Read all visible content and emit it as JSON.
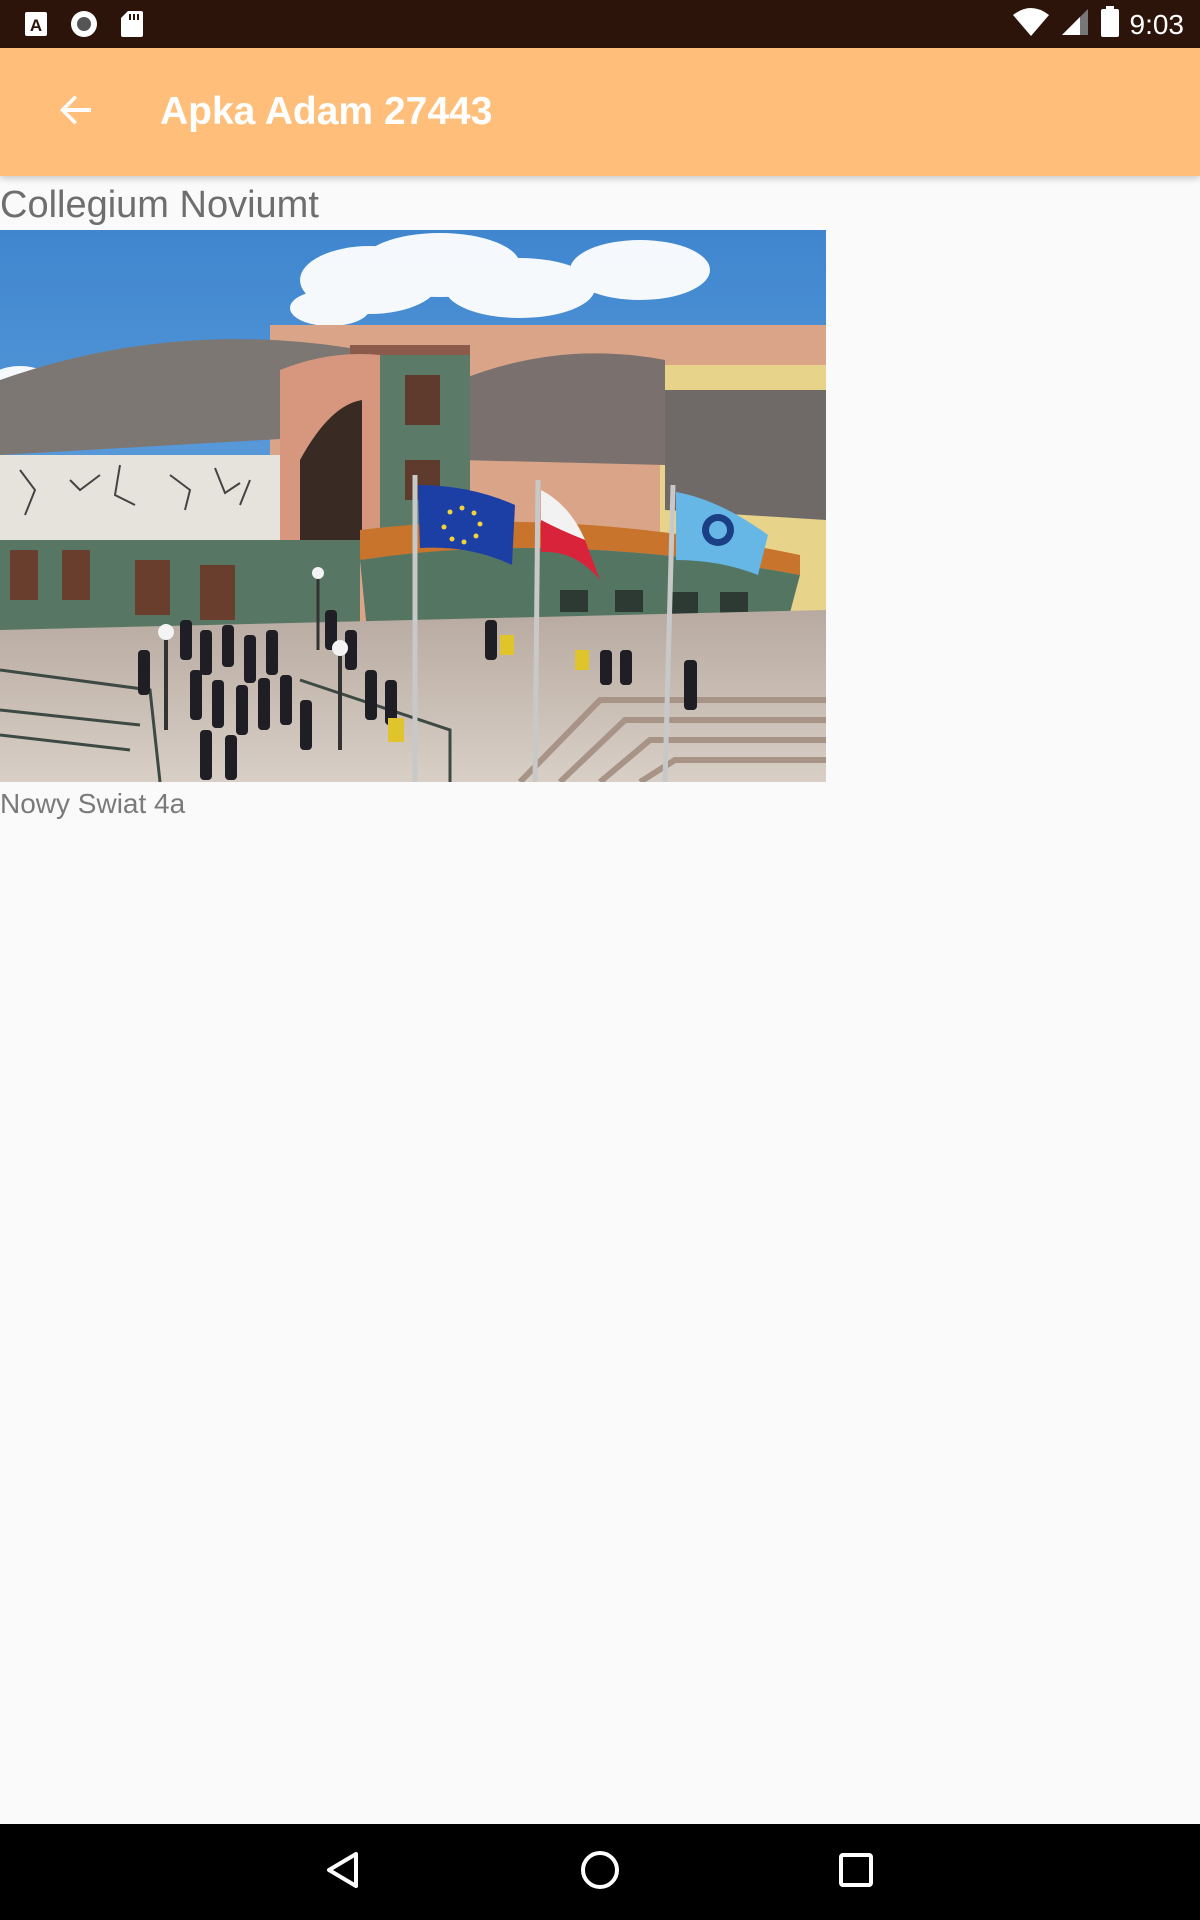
{
  "status_bar": {
    "time": "9:03",
    "icons_left": [
      "a-keyboard-icon",
      "record-icon",
      "sd-card-icon"
    ],
    "icons_right": [
      "wifi-icon",
      "cell-signal-icon",
      "battery-icon"
    ]
  },
  "app_bar": {
    "title": "Apka Adam 27443",
    "back_icon": "arrow-back-icon",
    "background_color": "#ffbf7a"
  },
  "place": {
    "title": "Collegium Noviumt",
    "address": "Nowy Swiat 4a",
    "photo": "building-photo"
  },
  "nav_bar": {
    "buttons": [
      "back-triangle-icon",
      "home-circle-icon",
      "recents-square-icon"
    ]
  }
}
